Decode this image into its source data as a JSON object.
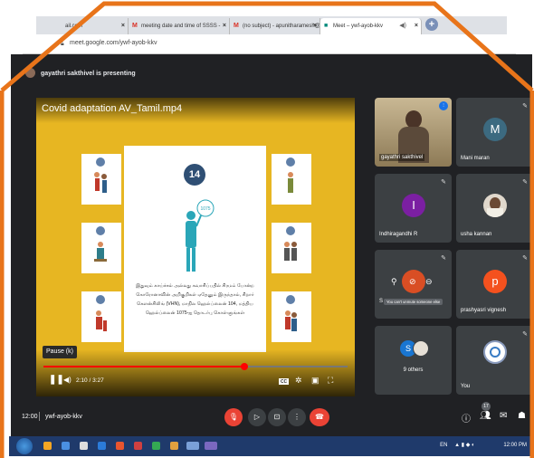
{
  "browser": {
    "tabs": [
      {
        "label": "ail.com",
        "icon": "mail-icon"
      },
      {
        "label": "meeting date and time of SSSS - ",
        "icon": "gmail-icon"
      },
      {
        "label": "(no subject) - apunitharamesh@",
        "icon": "gmail-icon"
      },
      {
        "label": "Meet – ywf-ayob-kkv",
        "icon": "meet-icon"
      }
    ],
    "new_tab": "+",
    "url": "meet.google.com/ywf-ayob-kkv"
  },
  "meet": {
    "presenting_text": "gayathri sakthivel is presenting",
    "video": {
      "title": "Covid adaptation AV_Tamil.mp4",
      "badge_number": "14",
      "card_text": "இதுவும் காய்ச்சல் அல்லது சுவாசிப்பதில் சிரமம் போன்ற கொரோனாவின் அறிகுறிகள் ஏதேனும் இருந்தால், சிறார் கெளன்சிலிங் (VHN), மாநில ஹெல்ப்லைன் 104, மத்திய ஹெல்ப்லைன் 1075-ஐ தொடர்பு கொள்ளுங்கள்",
      "pause_tooltip": "Pause (k)",
      "time": "2:10 / 3:27",
      "progress_fraction": 0.66
    },
    "participants": [
      {
        "name": "gayathri sakthivel",
        "type": "video"
      },
      {
        "name": "Mani maran",
        "initial": "M",
        "color": "#3c6a80"
      },
      {
        "name": "Indhiragandhi R",
        "initial": "I",
        "color": "#7b1fa2"
      },
      {
        "name": "usha kannan",
        "type": "photo"
      },
      {
        "name": "S",
        "tooltip": "You can't unmute someone else"
      },
      {
        "name": "prashyasri vignesh",
        "initial": "p",
        "color": "#f4511e"
      },
      {
        "name": "9 others",
        "initial": "S",
        "color": "#1976d2"
      },
      {
        "name": "You",
        "type": "logo"
      }
    ],
    "bottom": {
      "clock": "12:00",
      "meeting_code": "ywf-ayob-kkv",
      "participant_count": "17"
    }
  },
  "taskbar": {
    "lang": "EN",
    "time": "12:00 PM"
  },
  "colors": {
    "border": "#e8741a",
    "meet_bg": "#202124",
    "tile_bg": "#3c4043",
    "video_bg": "#e7b622",
    "end_call": "#ea4335"
  }
}
